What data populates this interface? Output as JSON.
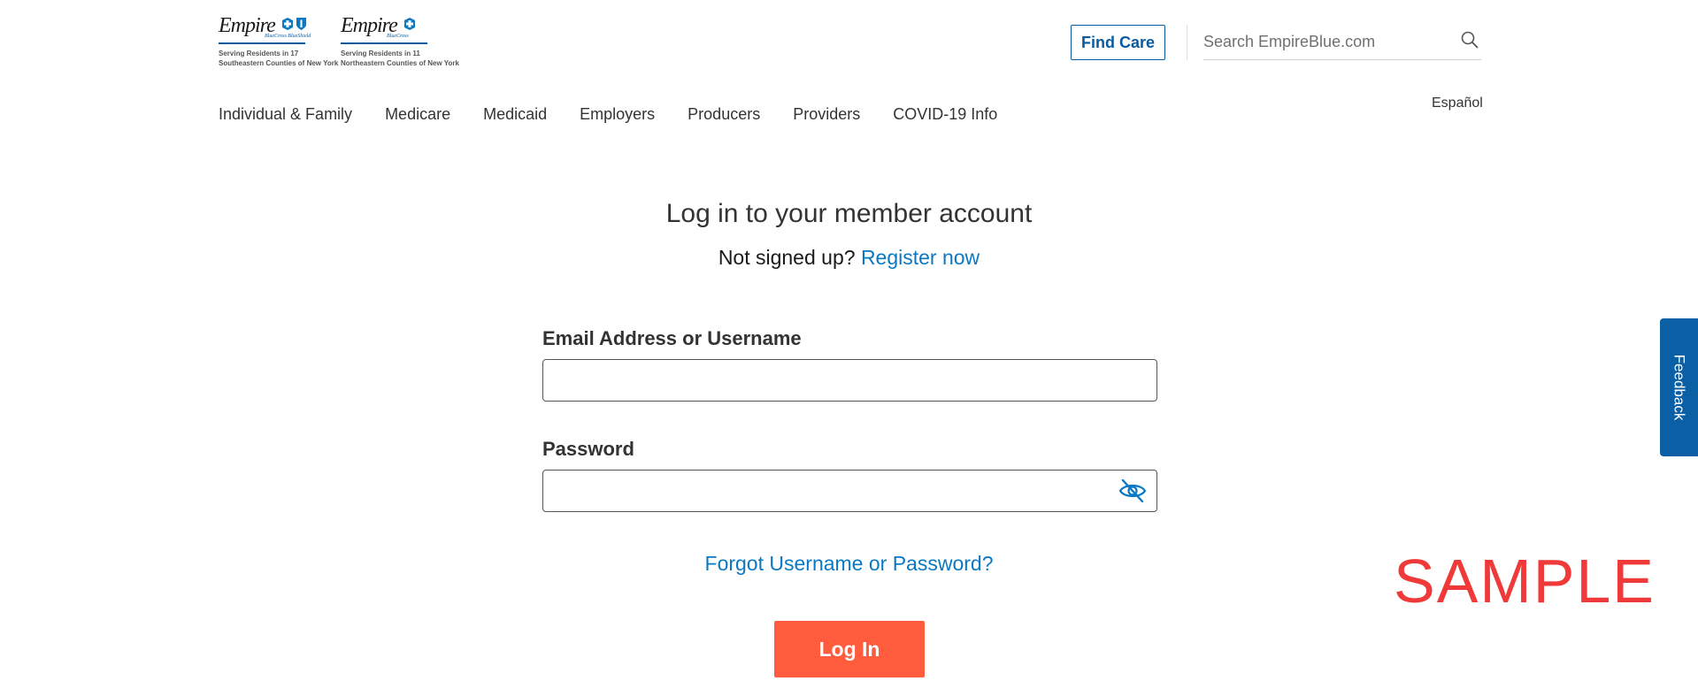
{
  "header": {
    "logos": [
      {
        "wordmark": "Empire",
        "subline": "BlueCross BlueShield",
        "tagline": "Serving Residents in 17 Southeastern Counties of New York"
      },
      {
        "wordmark": "Empire",
        "subline": "BlueCross",
        "tagline": "Serving Residents in 11 Northeastern Counties of New York"
      }
    ],
    "find_care_label": "Find Care",
    "search": {
      "placeholder": "Search EmpireBlue.com",
      "icon": "search-icon"
    },
    "language_link": "Español"
  },
  "nav": {
    "items": [
      "Individual & Family",
      "Medicare",
      "Medicaid",
      "Employers",
      "Producers",
      "Providers",
      "COVID-19 Info"
    ]
  },
  "login": {
    "title": "Log in to your member account",
    "signup_prompt": "Not signed up?",
    "register_link": "Register now",
    "email_label": "Email Address or Username",
    "email_value": "",
    "password_label": "Password",
    "password_value": "",
    "password_toggle_icon": "eye-slash-icon",
    "forgot_link": "Forgot Username or Password?",
    "submit_label": "Log In"
  },
  "watermark": "SAMPLE",
  "feedback_label": "Feedback",
  "colors": {
    "brand_blue": "#0a5aa0",
    "link_blue": "#0a78c2",
    "cta_orange": "#ff5c3e",
    "watermark_red": "#f03a3a",
    "feedback_blue": "#0b5fa5"
  }
}
